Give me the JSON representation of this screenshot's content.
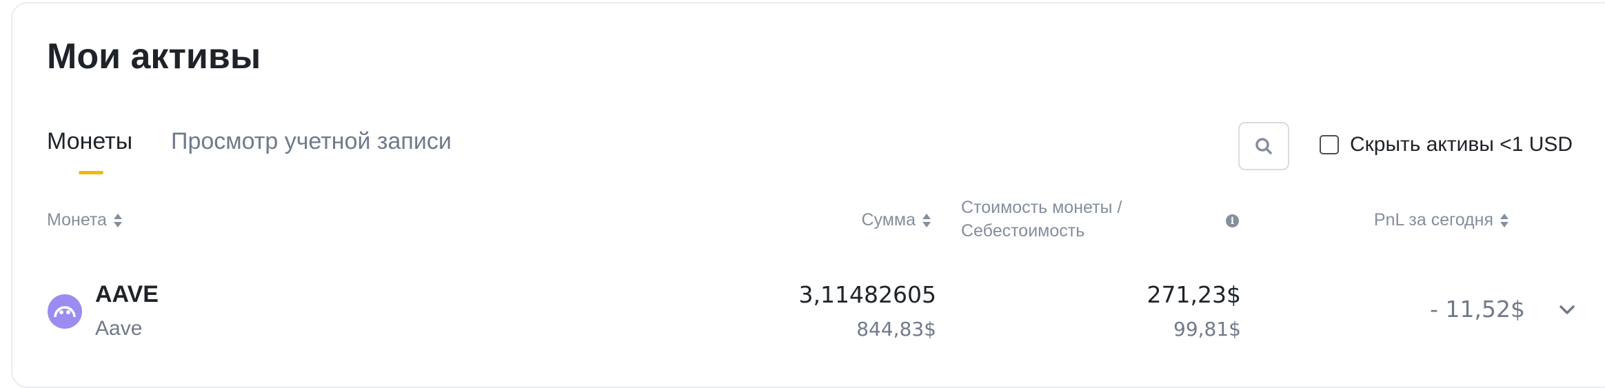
{
  "header": {
    "title": "Мои активы"
  },
  "tabs": {
    "coins": "Монеты",
    "account": "Просмотр учетной записи"
  },
  "toolbar": {
    "hide_small_label": "Скрыть активы <1 USD",
    "hide_small_checked": false
  },
  "table": {
    "columns": {
      "coin": "Монета",
      "amount": "Сумма",
      "price_line1": "Стоимость монеты /",
      "price_line2": "Себестоимость",
      "pnl": "PnL за сегодня"
    },
    "rows": [
      {
        "symbol": "AAVE",
        "name": "Aave",
        "amount": "3,11482605",
        "amount_value": "844,83$",
        "price": "271,23$",
        "cost": "99,81$",
        "pnl_today": "- 11,52$"
      }
    ]
  },
  "colors": {
    "accent": "#f0b90b",
    "aave_logo": "#9a8cf0"
  },
  "icons": {
    "search": "search-icon",
    "info": "info-icon",
    "expand": "chevron-down-icon",
    "coin": "aave-logo-icon"
  }
}
